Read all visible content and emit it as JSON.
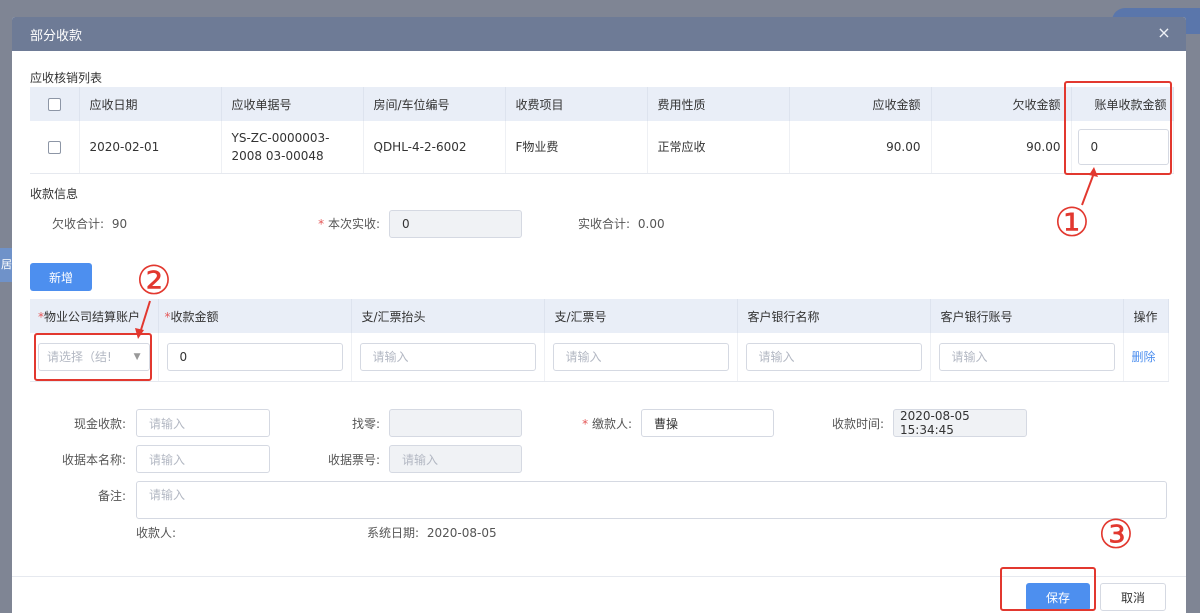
{
  "modal": {
    "title": "部分收款",
    "close_icon": "×"
  },
  "backdrop": {
    "side_label": "居"
  },
  "receivable": {
    "section_title": "应收核销列表",
    "columns": [
      "应收日期",
      "应收单据号",
      "房间/车位编号",
      "收费项目",
      "费用性质",
      "应收金额",
      "欠收金额",
      "账单收款金额"
    ],
    "rows": [
      {
        "date": "2020-02-01",
        "doc_no": "YS-ZC-0000003-2008 03-00048",
        "room": "QDHL-4-2-6002",
        "item": "F物业费",
        "nature": "正常应收",
        "receivable_amount": "90.00",
        "owed_amount": "90.00",
        "bill_amount": "0"
      }
    ]
  },
  "collection": {
    "section_title": "收款信息",
    "owed_total_label": "欠收合计:",
    "owed_total_value": "90",
    "current_paid_label": "本次实收:",
    "current_paid_value": "0",
    "actual_total_label": "实收合计:",
    "actual_total_value": "0.00"
  },
  "accounts": {
    "add_button": "新增",
    "columns": [
      "物业公司结算账户",
      "收款金额",
      "支/汇票抬头",
      "支/汇票号",
      "客户银行名称",
      "客户银行账号",
      "操作"
    ],
    "rows": [
      {
        "account_placeholder": "请选择（结!",
        "amount": "0",
        "draft_title_placeholder": "请输入",
        "draft_no_placeholder": "请输入",
        "bank_name_placeholder": "请输入",
        "bank_account_placeholder": "请输入",
        "delete_label": "删除"
      }
    ]
  },
  "form": {
    "cash_label": "现金收款:",
    "cash_placeholder": "请输入",
    "change_label": "找零:",
    "payer_label": "缴款人:",
    "payer_value": "曹操",
    "time_label": "收款时间:",
    "time_value": "2020-08-05 15:34:45",
    "receipt_book_label": "收据本名称:",
    "receipt_book_placeholder": "请输入",
    "receipt_no_label": "收据票号:",
    "receipt_no_placeholder": "请输入",
    "remark_label": "备注:",
    "remark_placeholder": "请输入",
    "receiver_label": "收款人:",
    "sys_date_label": "系统日期:",
    "sys_date_value": "2020-08-05"
  },
  "footer": {
    "save_label": "保存",
    "cancel_label": "取消"
  },
  "annotations": [
    "①",
    "②",
    "③"
  ],
  "colors": {
    "header_bg": "#6e7b96",
    "primary": "#4d8fef",
    "annotation_red": "#e2382f",
    "table_header_bg": "#e9eef7"
  }
}
